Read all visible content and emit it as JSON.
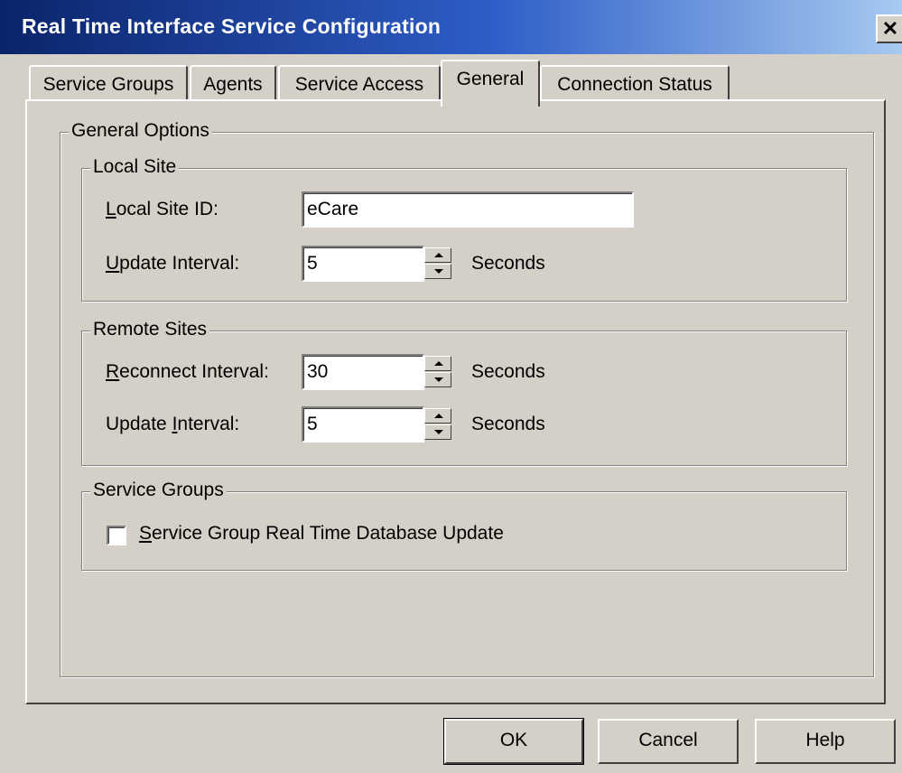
{
  "window": {
    "title": "Real Time Interface Service Configuration",
    "close_glyph": "✕"
  },
  "tabs": [
    {
      "label": "Service Groups",
      "active": false
    },
    {
      "label": "Agents",
      "active": false
    },
    {
      "label": "Service Access",
      "active": false
    },
    {
      "label": "General",
      "active": true
    },
    {
      "label": "Connection Status",
      "active": false
    }
  ],
  "general_options": {
    "legend": "General Options",
    "local_site": {
      "legend": "Local Site",
      "site_id_label": "Local Site ID:",
      "site_id_value": "eCare",
      "update_interval_label": "Update Interval:",
      "update_interval_value": "5",
      "update_interval_unit": "Seconds"
    },
    "remote_sites": {
      "legend": "Remote Sites",
      "reconnect_interval_label": "Reconnect Interval:",
      "reconnect_interval_value": "30",
      "reconnect_interval_unit": "Seconds",
      "update_interval_label": "Update Interval:",
      "update_interval_value": "5",
      "update_interval_unit": "Seconds"
    },
    "service_groups": {
      "legend": "Service Groups",
      "rt_db_update_label": "Service Group Real Time Database Update",
      "rt_db_update_checked": false
    }
  },
  "buttons": {
    "ok": "OK",
    "cancel": "Cancel",
    "help": "Help"
  },
  "colors": {
    "titlebar_start": "#0a246a",
    "titlebar_end": "#a6caf0",
    "face": "#d4d0c8"
  }
}
